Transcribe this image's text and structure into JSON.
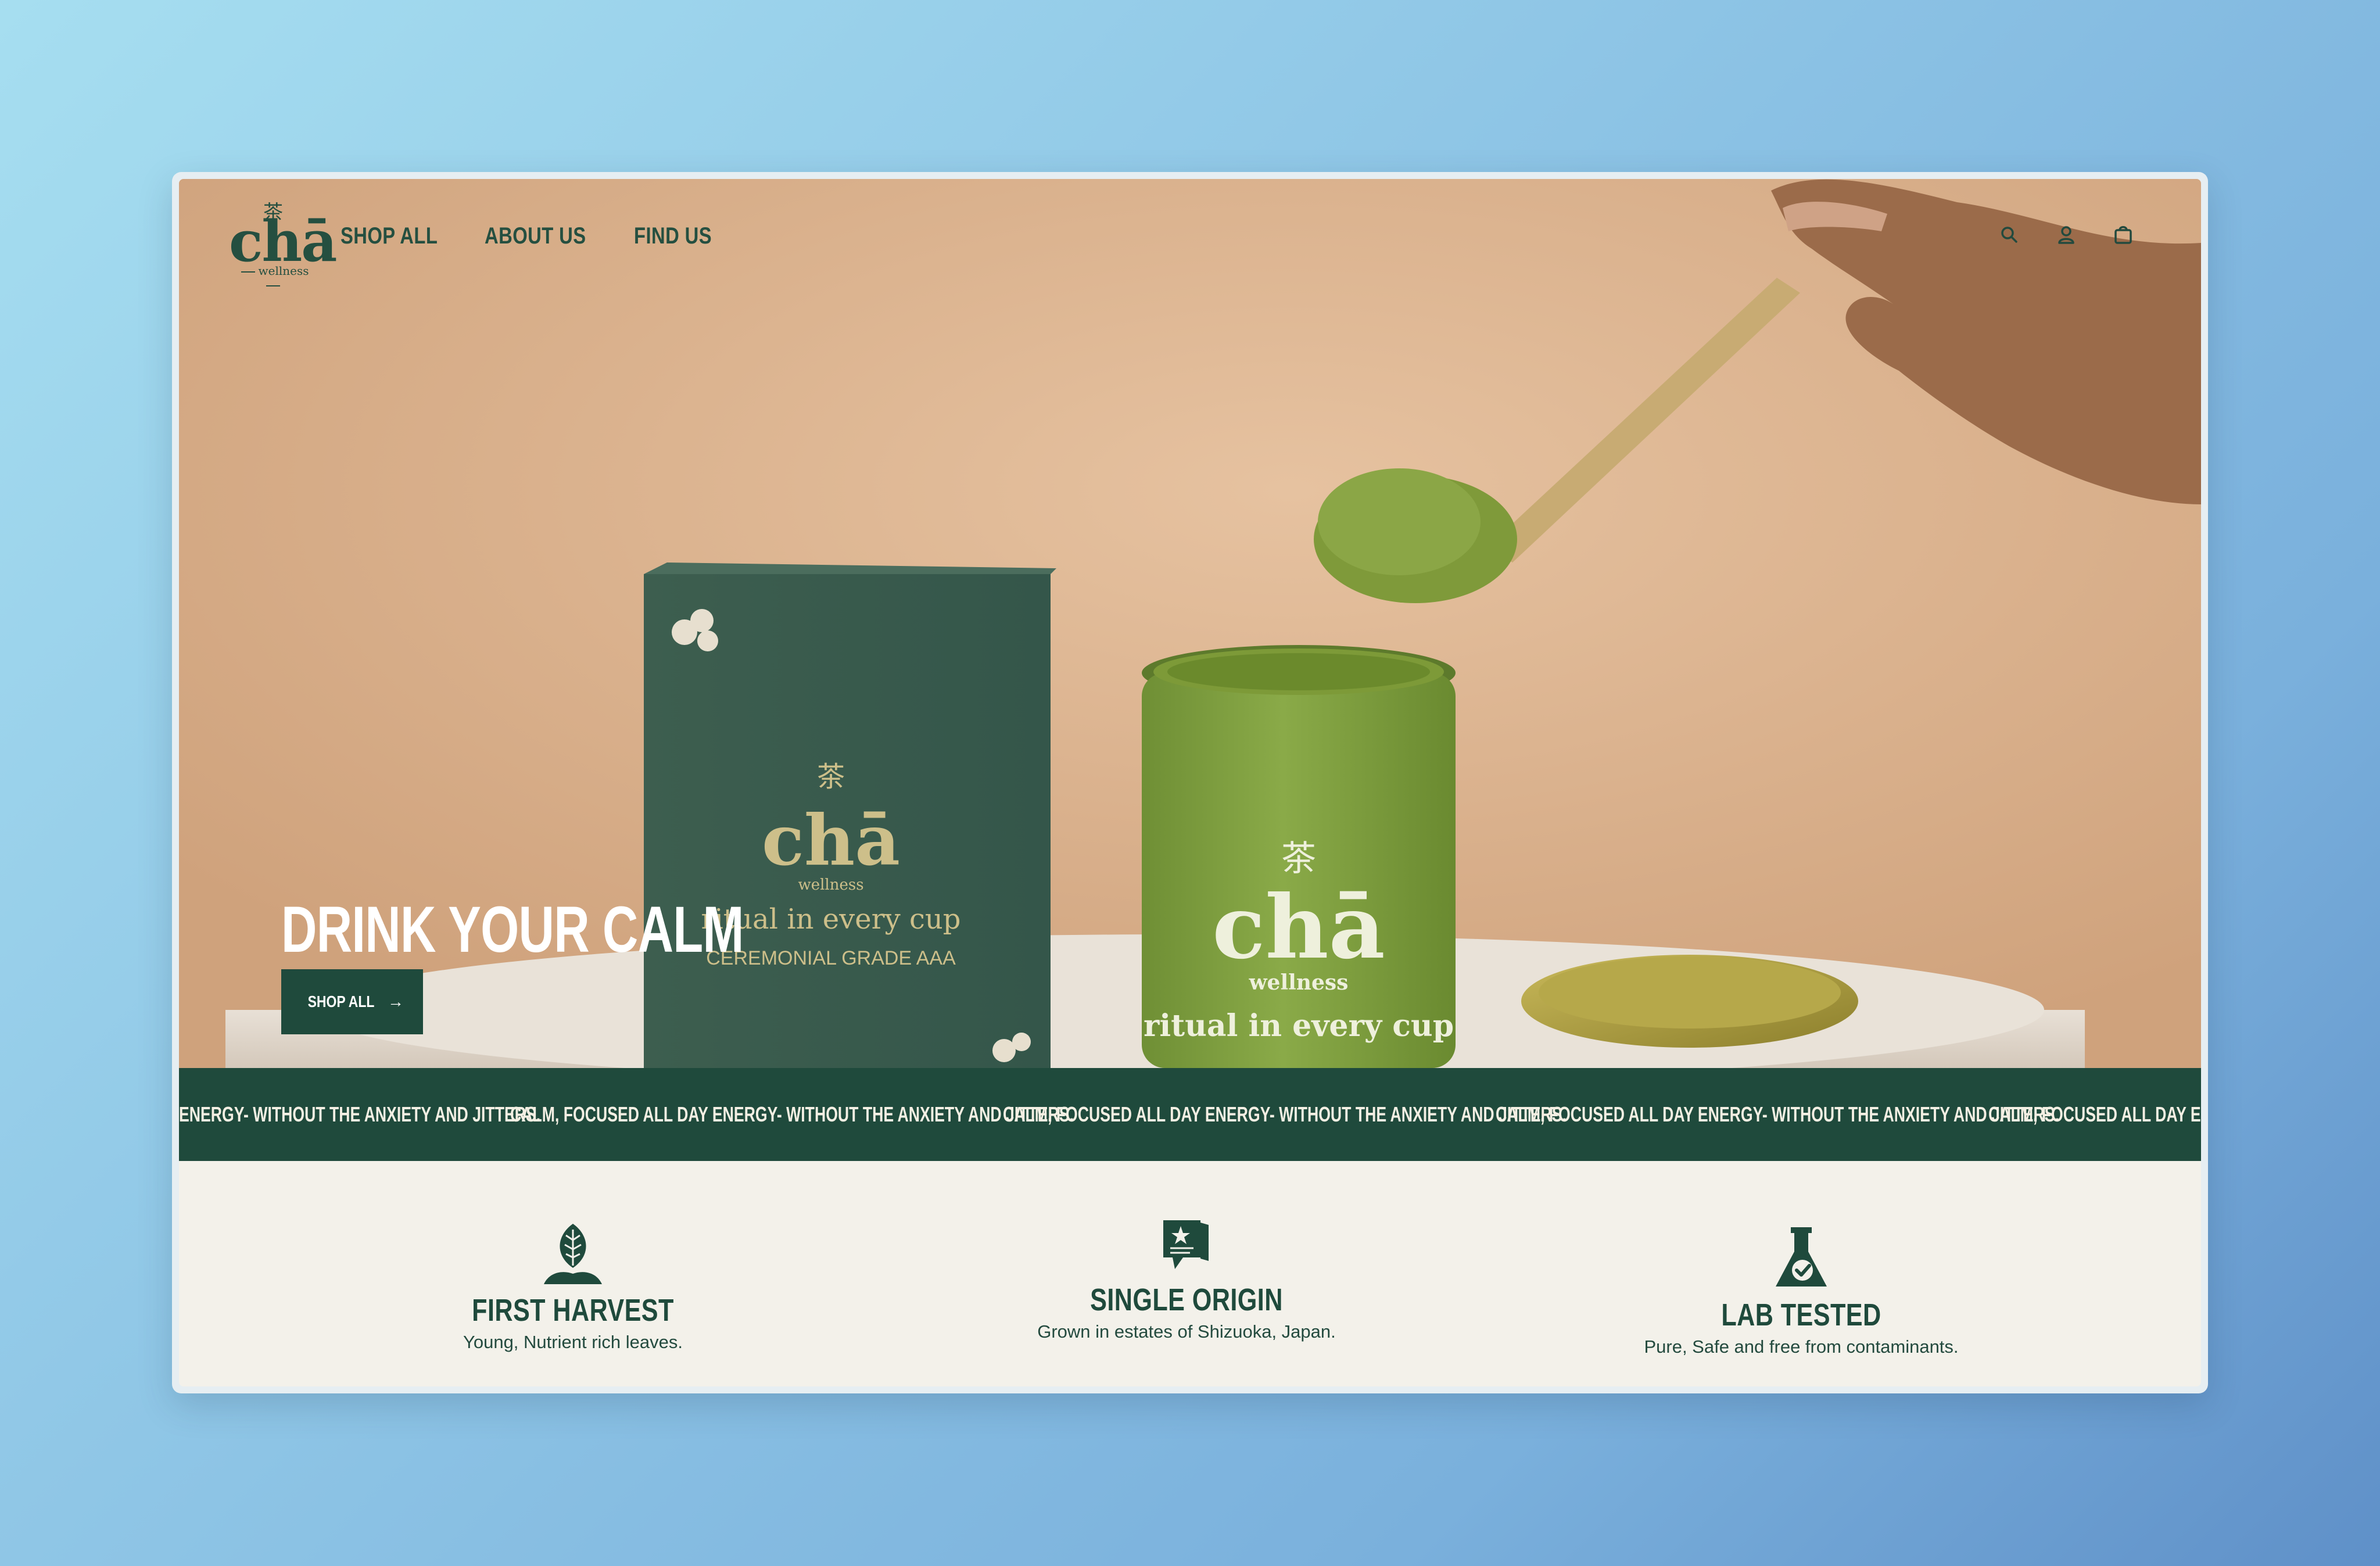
{
  "brand": {
    "glyph": "茶",
    "name": "chā",
    "tagline": "wellness"
  },
  "nav": {
    "links": [
      "SHOP ALL",
      "ABOUT US",
      "FIND US"
    ],
    "icons": [
      "search-icon",
      "account-icon",
      "cart-icon"
    ]
  },
  "hero": {
    "headline": "DRINK YOUR CALM",
    "cta_label": "SHOP ALL",
    "cta_arrow": "→",
    "box_text": {
      "glyph": "茶",
      "name": "chā",
      "sub": "wellness",
      "line1": "ritual in every cup",
      "line2": "CEREMONIAL GRADE AAA"
    },
    "jar_text": {
      "glyph": "茶",
      "name": "chā",
      "sub": "wellness",
      "line1": "ritual in every cup"
    }
  },
  "marquee": {
    "items": [
      "ENERGY- WITHOUT THE ANXIETY AND JITTERS.",
      "CALM, FOCUSED ALL DAY ENERGY- WITHOUT THE ANXIETY AND JITTERS.",
      "CALM, FOCUSED ALL DAY ENERGY- WITHOUT THE ANXIETY AND JITTERS.",
      "CALM, FOCUSED ALL DAY ENERGY- WITHOUT THE ANXIETY AND JITTERS.",
      "CALM, FOCUSED ALL DAY ENERG"
    ]
  },
  "features": [
    {
      "icon": "sprout-icon",
      "title": "FIRST HARVEST",
      "desc": "Young, Nutrient rich leaves."
    },
    {
      "icon": "certificate-icon",
      "title": "SINGLE ORIGIN",
      "desc": "Grown in estates of Shizuoka, Japan."
    },
    {
      "icon": "flask-icon",
      "title": "LAB TESTED",
      "desc": "Pure, Safe and free from contaminants."
    }
  ],
  "colors": {
    "brand_green": "#1f4a3c",
    "hero_bg": "#d8b08d",
    "cream": "#f3f1ea"
  }
}
